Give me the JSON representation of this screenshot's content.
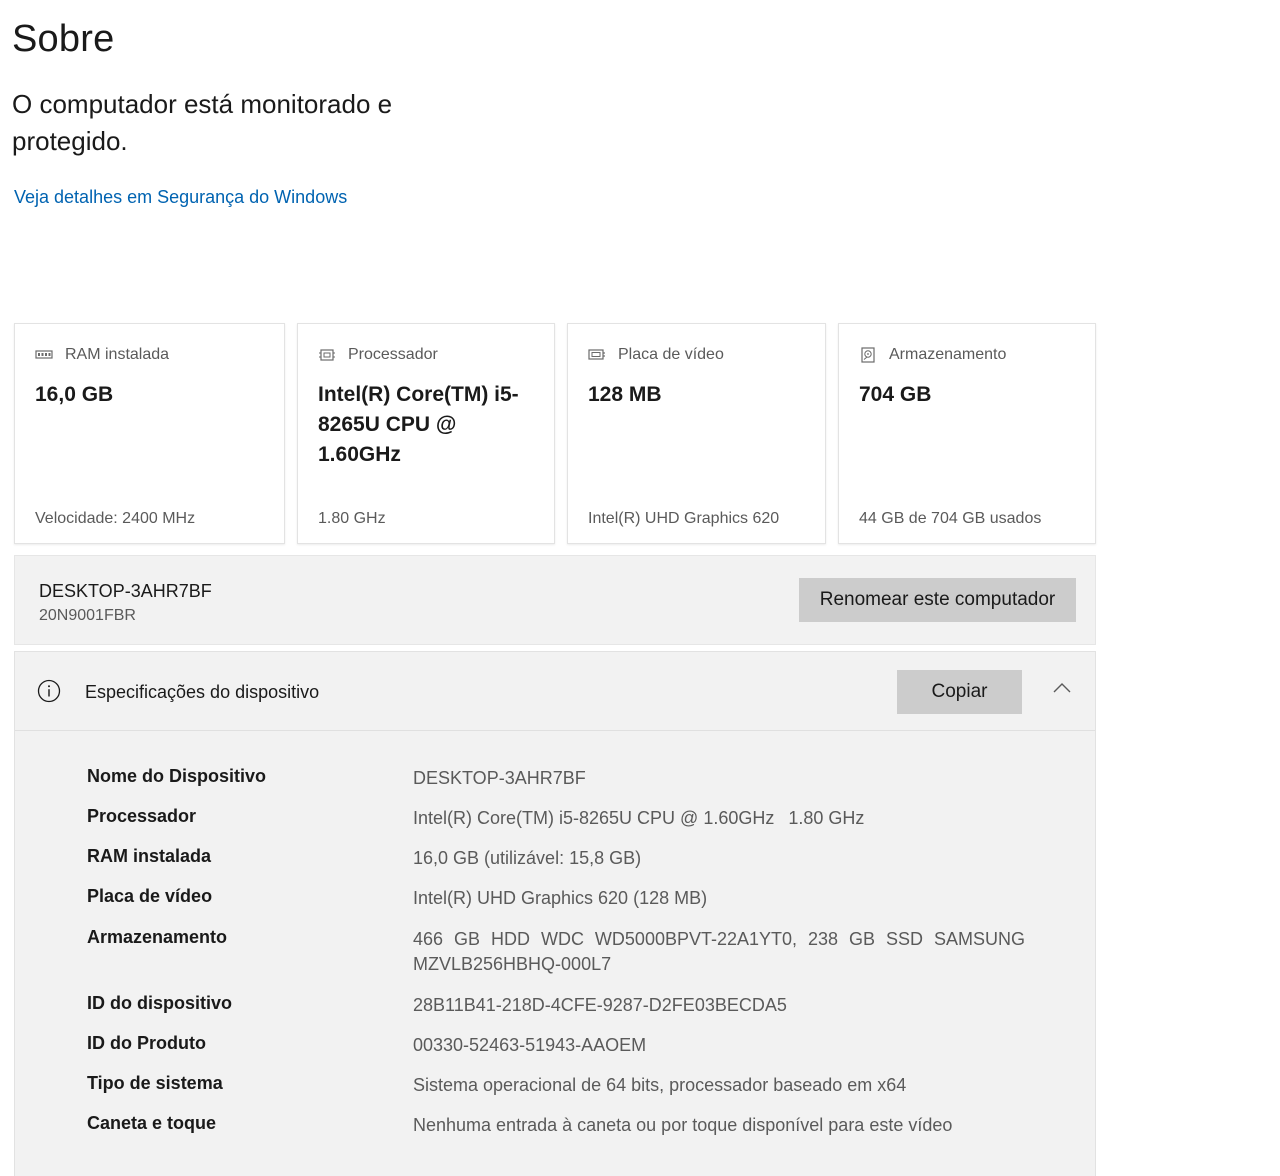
{
  "page": {
    "title": "Sobre"
  },
  "security": {
    "status": "O computador está monitorado e protegido.",
    "link": "Veja detalhes em Segurança do Windows"
  },
  "cards": [
    {
      "icon": "ram-icon",
      "label": "RAM instalada",
      "value": "16,0 GB",
      "footer": "Velocidade: 2400 MHz"
    },
    {
      "icon": "processor-icon",
      "label": "Processador",
      "value": "Intel(R) Core(TM) i5-8265U CPU @ 1.60GHz",
      "footer": "1.80 GHz"
    },
    {
      "icon": "gpu-icon",
      "label": "Placa de vídeo",
      "value": "128 MB",
      "footer": "Intel(R) UHD Graphics 620"
    },
    {
      "icon": "storage-icon",
      "label": "Armazenamento",
      "value": "704 GB",
      "footer": "44 GB de 704 GB usados"
    }
  ],
  "device": {
    "name": "DESKTOP-3AHR7BF",
    "model": "20N9001FBR",
    "rename_label": "Renomear este computador"
  },
  "specs": {
    "title": "Especificações do dispositivo",
    "copy_label": "Copiar",
    "rows": [
      {
        "label": "Nome do Dispositivo",
        "value": "DESKTOP-3AHR7BF"
      },
      {
        "label": "Processador",
        "value": "Intel(R) Core(TM) i5-8265U CPU @ 1.60GHz",
        "value_extra": "1.80 GHz"
      },
      {
        "label": "RAM instalada",
        "value": "16,0 GB (utilizável: 15,8 GB)"
      },
      {
        "label": "Placa de vídeo",
        "value": "Intel(R) UHD Graphics 620 (128 MB)"
      },
      {
        "label": "Armazenamento",
        "value": "466 GB HDD WDC WD5000BPVT-22A1YT0, 238 GB SSD SAMSUNG MZVLB256HBHQ-000L7"
      },
      {
        "label": "ID do dispositivo",
        "value": "28B11B41-218D-4CFE-9287-D2FE03BECDA5"
      },
      {
        "label": "ID do Produto",
        "value": "00330-52463-51943-AAOEM"
      },
      {
        "label": "Tipo de sistema",
        "value": "Sistema operacional de 64 bits, processador baseado em x64"
      },
      {
        "label": "Caneta e toque",
        "value": "Nenhuma entrada à caneta ou por toque disponível para este vídeo"
      }
    ]
  },
  "colors": {
    "link": "#0063b1",
    "panel_background": "#f2f2f2",
    "button_background": "#cccccc"
  }
}
